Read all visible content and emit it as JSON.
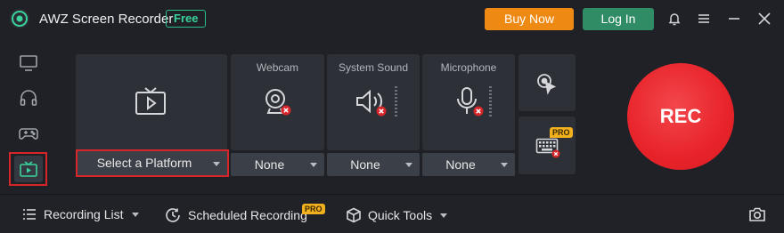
{
  "header": {
    "app_title": "AWZ Screen Recorder",
    "plan_badge": "Free",
    "buy_label": "Buy Now",
    "login_label": "Log In",
    "colors": {
      "buy": "#ee8a14",
      "login": "#2f8c64",
      "badge": "#39d39b"
    }
  },
  "sidebar": {
    "items": [
      {
        "name": "screen",
        "icon": "monitor-icon",
        "active": false
      },
      {
        "name": "audio",
        "icon": "headphones-icon",
        "active": false
      },
      {
        "name": "game",
        "icon": "gamepad-icon",
        "active": false
      },
      {
        "name": "live",
        "icon": "tv-icon",
        "active": true
      }
    ]
  },
  "source": {
    "icon": "tv-icon",
    "platform_label": "Select a Platform"
  },
  "devices": [
    {
      "label": "Webcam",
      "icon": "webcam-icon",
      "value": "None",
      "disabled": true
    },
    {
      "label": "System Sound",
      "icon": "speaker-icon",
      "value": "None",
      "disabled": true
    },
    {
      "label": "Microphone",
      "icon": "microphone-icon",
      "value": "None",
      "disabled": true
    }
  ],
  "tools": {
    "cursor_icon": "cursor-click-icon",
    "keyboard_icon": "keyboard-icon",
    "pro_label": "PRO"
  },
  "rec_label": "REC",
  "bottom": {
    "recording_list": "Recording List",
    "scheduled_recording": "Scheduled Recording",
    "scheduled_pro": "PRO",
    "quick_tools": "Quick Tools"
  }
}
